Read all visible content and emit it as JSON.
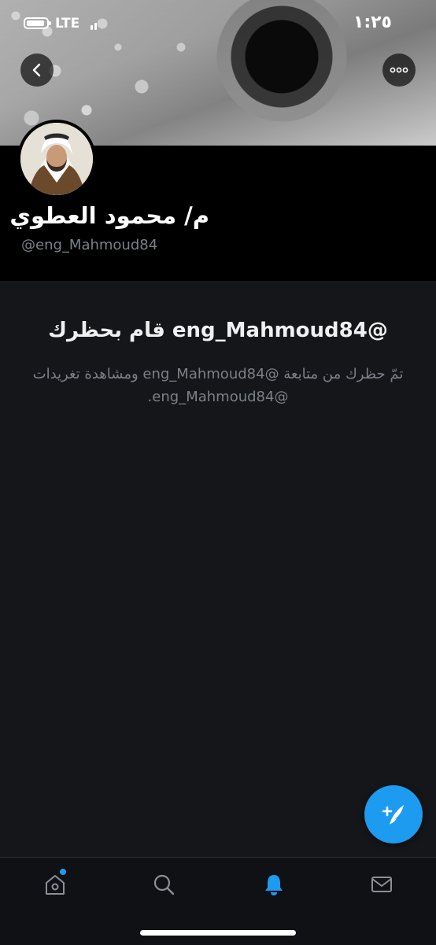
{
  "status_bar": {
    "carrier": "LTE",
    "time": "١:٢٥"
  },
  "header": {
    "back_icon": "chevron-left-icon",
    "more_icon": "more-dots-icon"
  },
  "profile": {
    "name": "م/ محمود العطوي",
    "handle": "@eng_Mahmoud84"
  },
  "blocked": {
    "title": "@eng_Mahmoud84 قام بحظرك",
    "description": "تمّ حظرك من متابعة @eng_Mahmoud84 ومشاهدة تغريدات @eng_Mahmoud84."
  },
  "compose": {
    "icon": "compose-tweet-icon"
  },
  "tabs": [
    {
      "name": "home",
      "icon": "home-icon",
      "active": false,
      "has_dot": true
    },
    {
      "name": "search",
      "icon": "search-icon",
      "active": false
    },
    {
      "name": "notifications",
      "icon": "bell-icon",
      "active": true
    },
    {
      "name": "messages",
      "icon": "mail-icon",
      "active": false
    }
  ],
  "colors": {
    "accent": "#1d9bf0",
    "background": "#151619",
    "muted_text": "#7b8088"
  }
}
